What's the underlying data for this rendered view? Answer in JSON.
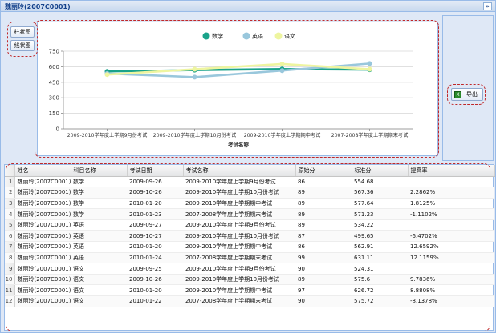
{
  "window": {
    "title": "魏丽玲(2007C0001)",
    "collapse_glyph": "»"
  },
  "buttons": {
    "bar_chart": "柱状图",
    "line_chart": "线状图",
    "export": "导出"
  },
  "chart_data": {
    "type": "line",
    "categories": [
      "2009-2010学年度上学期9月份考试",
      "2009-2010学年度上学期10月份考试",
      "2009-2010学年度上学期期中考试",
      "2007-2008学年度上学期期末考试"
    ],
    "series": [
      {
        "name": "数学",
        "color": "#1aa38a",
        "values": [
          554.68,
          567.36,
          577.64,
          571.23
        ]
      },
      {
        "name": "英语",
        "color": "#99c7dc",
        "values": [
          534.22,
          499.65,
          562.91,
          631.11
        ]
      },
      {
        "name": "语文",
        "color": "#eef5a0",
        "values": [
          524.31,
          575.6,
          626.72,
          575.72
        ]
      }
    ],
    "xlabel": "考试名称",
    "ylabel": "",
    "ylim": [
      0,
      750
    ],
    "yticks": [
      "0",
      "150",
      "300",
      "450",
      "600",
      "750"
    ],
    "grid": true,
    "legend_position": "top-center"
  },
  "grid": {
    "columns": [
      "姓名",
      "科目名称",
      "考试日期",
      "考试名称",
      "原始分",
      "标准分",
      "提高率"
    ],
    "rows": [
      {
        "n": "1",
        "name": "魏丽玲(2007C0001)",
        "subject": "数学",
        "date": "2009-09-26",
        "exam": "2009-2010学年度上学期9月份考试",
        "raw": "86",
        "std": "554.68",
        "rate": ""
      },
      {
        "n": "2",
        "name": "魏丽玲(2007C0001)",
        "subject": "数学",
        "date": "2009-10-26",
        "exam": "2009-2010学年度上学期10月份考试",
        "raw": "89",
        "std": "567.36",
        "rate": "2.2862%"
      },
      {
        "n": "3",
        "name": "魏丽玲(2007C0001)",
        "subject": "数学",
        "date": "2010-01-20",
        "exam": "2009-2010学年度上学期期中考试",
        "raw": "89",
        "std": "577.64",
        "rate": "1.8125%"
      },
      {
        "n": "4",
        "name": "魏丽玲(2007C0001)",
        "subject": "数学",
        "date": "2010-01-23",
        "exam": "2007-2008学年度上学期期末考试",
        "raw": "89",
        "std": "571.23",
        "rate": "-1.1102%"
      },
      {
        "n": "5",
        "name": "魏丽玲(2007C0001)",
        "subject": "英语",
        "date": "2009-09-27",
        "exam": "2009-2010学年度上学期9月份考试",
        "raw": "89",
        "std": "534.22",
        "rate": ""
      },
      {
        "n": "6",
        "name": "魏丽玲(2007C0001)",
        "subject": "英语",
        "date": "2009-10-27",
        "exam": "2009-2010学年度上学期10月份考试",
        "raw": "87",
        "std": "499.65",
        "rate": "-6.4702%"
      },
      {
        "n": "7",
        "name": "魏丽玲(2007C0001)",
        "subject": "英语",
        "date": "2010-01-20",
        "exam": "2009-2010学年度上学期期中考试",
        "raw": "86",
        "std": "562.91",
        "rate": "12.6592%"
      },
      {
        "n": "8",
        "name": "魏丽玲(2007C0001)",
        "subject": "英语",
        "date": "2010-01-24",
        "exam": "2007-2008学年度上学期期末考试",
        "raw": "99",
        "std": "631.11",
        "rate": "12.1159%"
      },
      {
        "n": "9",
        "name": "魏丽玲(2007C0001)",
        "subject": "语文",
        "date": "2009-09-25",
        "exam": "2009-2010学年度上学期9月份考试",
        "raw": "90",
        "std": "524.31",
        "rate": ""
      },
      {
        "n": "10",
        "name": "魏丽玲(2007C0001)",
        "subject": "语文",
        "date": "2009-10-26",
        "exam": "2009-2010学年度上学期10月份考试",
        "raw": "89",
        "std": "575.6",
        "rate": "9.7836%"
      },
      {
        "n": "11",
        "name": "魏丽玲(2007C0001)",
        "subject": "语文",
        "date": "2010-01-20",
        "exam": "2009-2010学年度上学期期中考试",
        "raw": "97",
        "std": "626.72",
        "rate": "8.8808%"
      },
      {
        "n": "12",
        "name": "魏丽玲(2007C0001)",
        "subject": "语文",
        "date": "2010-01-22",
        "exam": "2007-2008学年度上学期期末考试",
        "raw": "90",
        "std": "575.72",
        "rate": "-8.1378%"
      }
    ]
  }
}
